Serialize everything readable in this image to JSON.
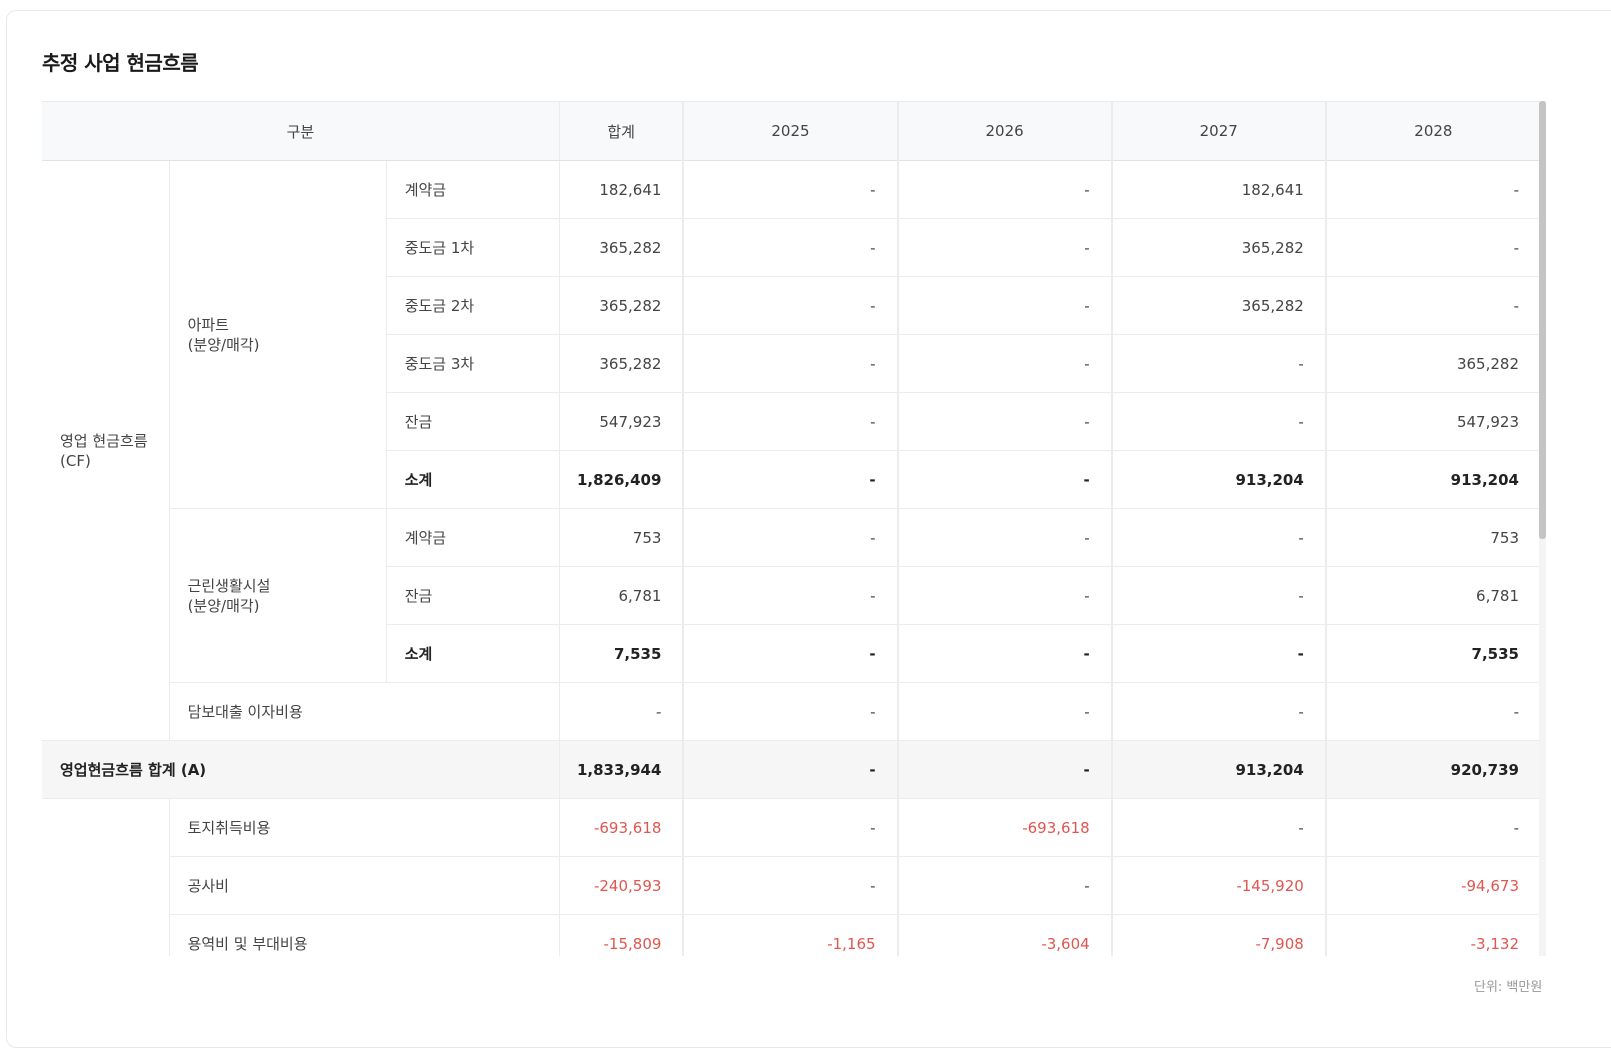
{
  "title": "추정 사업 현금흐름",
  "unit_label": "단위: 백만원",
  "table": {
    "headers": {
      "category": "구분",
      "sum": "합계",
      "years": [
        "2025",
        "2026",
        "2027",
        "2028"
      ]
    },
    "groups": {
      "operating": "영업 현금흐름\n(CF)",
      "apartment": "아파트\n(분양/매각)",
      "neighborhood": "근린생활시설\n(분양/매각)"
    },
    "rows": [
      {
        "label": "계약금",
        "sum": "182,641",
        "y": [
          "-",
          "-",
          "182,641",
          "-"
        ]
      },
      {
        "label": "중도금 1차",
        "sum": "365,282",
        "y": [
          "-",
          "-",
          "365,282",
          "-"
        ]
      },
      {
        "label": "중도금 2차",
        "sum": "365,282",
        "y": [
          "-",
          "-",
          "365,282",
          "-"
        ]
      },
      {
        "label": "중도금 3차",
        "sum": "365,282",
        "y": [
          "-",
          "-",
          "-",
          "365,282"
        ]
      },
      {
        "label": "잔금",
        "sum": "547,923",
        "y": [
          "-",
          "-",
          "-",
          "547,923"
        ]
      },
      {
        "label": "소계",
        "sum": "1,826,409",
        "y": [
          "-",
          "-",
          "913,204",
          "913,204"
        ]
      },
      {
        "label": "계약금",
        "sum": "753",
        "y": [
          "-",
          "-",
          "-",
          "753"
        ]
      },
      {
        "label": "잔금",
        "sum": "6,781",
        "y": [
          "-",
          "-",
          "-",
          "6,781"
        ]
      },
      {
        "label": "소계",
        "sum": "7,535",
        "y": [
          "-",
          "-",
          "-",
          "7,535"
        ]
      },
      {
        "label": "담보대출 이자비용",
        "sum": "-",
        "y": [
          "-",
          "-",
          "-",
          "-"
        ]
      },
      {
        "label": "영업현금흐름 합계 (A)",
        "sum": "1,833,944",
        "y": [
          "-",
          "-",
          "913,204",
          "920,739"
        ]
      },
      {
        "label": "토지취득비용",
        "sum": "-693,618",
        "y": [
          "-",
          "-693,618",
          "-",
          "-"
        ]
      },
      {
        "label": "공사비",
        "sum": "-240,593",
        "y": [
          "-",
          "-",
          "-145,920",
          "-94,673"
        ]
      },
      {
        "label": "용역비 및 부대비용",
        "sum": "-15,809",
        "y": [
          "-1,165",
          "-3,604",
          "-7,908",
          "-3,132"
        ]
      }
    ]
  },
  "colors": {
    "negative": "#e0564f",
    "header_bg": "#f8f9fb",
    "total_bg": "#f6f6f6"
  }
}
